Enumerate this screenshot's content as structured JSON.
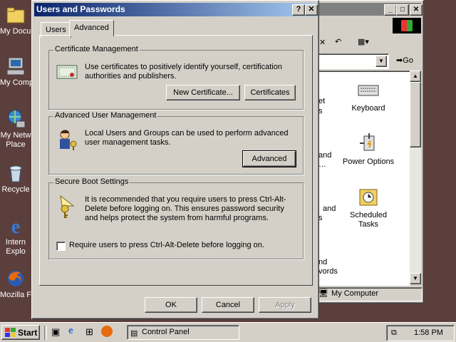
{
  "desktop": {
    "icons": [
      {
        "label": "My Docum",
        "icon": "folder-documents-icon"
      },
      {
        "label": "My Comp",
        "icon": "computer-icon"
      },
      {
        "label": "My Netw Place",
        "icon": "network-icon"
      },
      {
        "label": "Recycle",
        "icon": "recycle-bin-icon"
      },
      {
        "label": "Intern Explo",
        "icon": "internet-explorer-icon"
      },
      {
        "label": "Mozilla Fi",
        "icon": "firefox-icon"
      }
    ]
  },
  "control_panel": {
    "go_label": "Go",
    "status_text": "My Computer",
    "icons": [
      {
        "label": "Keyboard",
        "icon": "keyboard-icon"
      },
      {
        "label": "Power Options",
        "icon": "power-options-icon"
      },
      {
        "label": "Scheduled Tasks",
        "icon": "scheduled-tasks-icon"
      }
    ],
    "clipped_labels": [
      "et",
      "s",
      "and",
      "…",
      "and",
      "s",
      "nd",
      "vords"
    ]
  },
  "dialog": {
    "title": "Users and Passwords",
    "tabs": [
      "Users",
      "Advanced"
    ],
    "active_tab": "Advanced",
    "cert": {
      "group_label": "Certificate Management",
      "text": "Use certificates to positively identify yourself, certification authorities and publishers.",
      "new_cert_button": "New Certificate...",
      "certs_button": "Certificates"
    },
    "advanced_user": {
      "group_label": "Advanced User Management",
      "text": "Local Users and Groups can be used to perform advanced user management tasks.",
      "advanced_button": "Advanced"
    },
    "secure_boot": {
      "group_label": "Secure Boot Settings",
      "text": "It is recommended that you require users to press Ctrl-Alt-Delete before logging on. This ensures password security and helps protect the system from harmful programs.",
      "checkbox_label": "Require users to press Ctrl-Alt-Delete before logging on.",
      "checked": false
    },
    "ok": "OK",
    "cancel": "Cancel",
    "apply": "Apply"
  },
  "taskbar": {
    "start": "Start",
    "task": "Control Panel",
    "clock": "1:58 PM"
  }
}
